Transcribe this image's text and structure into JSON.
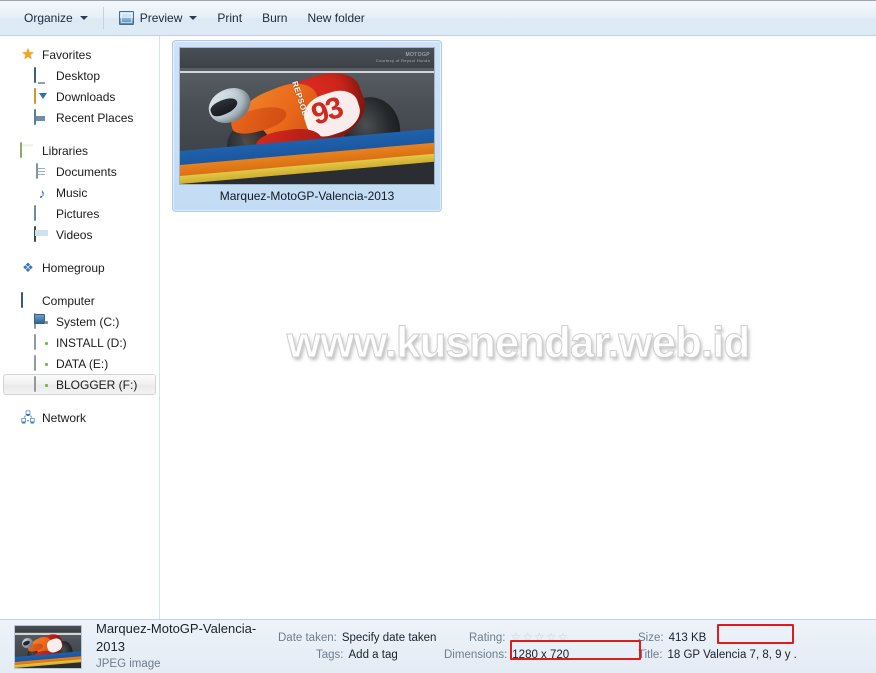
{
  "toolbar": {
    "items": [
      {
        "label": "Organize",
        "icon": "none",
        "caret": true
      },
      {
        "label": "Preview",
        "icon": "preview-icon",
        "caret": true
      },
      {
        "label": "Print",
        "icon": "none",
        "caret": false
      },
      {
        "label": "Burn",
        "icon": "none",
        "caret": false
      },
      {
        "label": "New folder",
        "icon": "none",
        "caret": false
      }
    ]
  },
  "sidebar": {
    "groups": [
      {
        "header": {
          "label": "Favorites",
          "icon": "star-icon"
        },
        "items": [
          {
            "label": "Desktop",
            "icon": "monitor-icon"
          },
          {
            "label": "Downloads",
            "icon": "download-folder-icon"
          },
          {
            "label": "Recent Places",
            "icon": "recent-places-icon"
          }
        ]
      },
      {
        "header": {
          "label": "Libraries",
          "icon": "library-icon"
        },
        "items": [
          {
            "label": "Documents",
            "icon": "document-icon"
          },
          {
            "label": "Music",
            "icon": "music-note-icon"
          },
          {
            "label": "Pictures",
            "icon": "picture-icon"
          },
          {
            "label": "Videos",
            "icon": "video-icon"
          }
        ]
      },
      {
        "header": {
          "label": "Homegroup",
          "icon": "homegroup-icon"
        },
        "items": []
      },
      {
        "header": {
          "label": "Computer",
          "icon": "computer-icon"
        },
        "items": [
          {
            "label": "System (C:)",
            "icon": "system-drive-icon",
            "selected": false
          },
          {
            "label": "INSTALL (D:)",
            "icon": "drive-icon",
            "selected": false
          },
          {
            "label": "DATA (E:)",
            "icon": "drive-icon",
            "selected": false
          },
          {
            "label": "BLOGGER (F:)",
            "icon": "drive-icon",
            "selected": true
          }
        ]
      },
      {
        "header": {
          "label": "Network",
          "icon": "network-icon"
        },
        "items": []
      }
    ]
  },
  "content": {
    "file_tile": {
      "label": "Marquez-MotoGP-Valencia-2013",
      "thumbnail_alt": "motogp-rider-photo",
      "photo_number": "93",
      "photo_sponsor": "REPSOL",
      "photo_logo_line1": "MOTOGP",
      "photo_logo_line2": "Courtesy of Repsol Honda"
    },
    "watermark": "www.kusnendar.web.id"
  },
  "statusbar": {
    "file_name": "Marquez-MotoGP-Valencia-2013",
    "file_type": "JPEG image",
    "date_taken_label": "Date taken:",
    "date_taken_value": "Specify date taken",
    "tags_label": "Tags:",
    "tags_value": "Add a tag",
    "rating_label": "Rating:",
    "rating_stars": [
      "☆",
      "☆",
      "☆",
      "☆",
      "☆"
    ],
    "rating_value": 0,
    "dimensions_label": "Dimensions:",
    "dimensions_value": "1280 x 720",
    "size_label": "Size:",
    "size_value": "413 KB",
    "title_label": "Title:",
    "title_value": "18 GP Valencia 7, 8, 9 y ."
  },
  "annotations": {
    "highlight_color": "#e01b1b",
    "boxes": [
      {
        "id": "box-dimensions",
        "target": "dimensions"
      },
      {
        "id": "box-size",
        "target": "size"
      }
    ]
  }
}
